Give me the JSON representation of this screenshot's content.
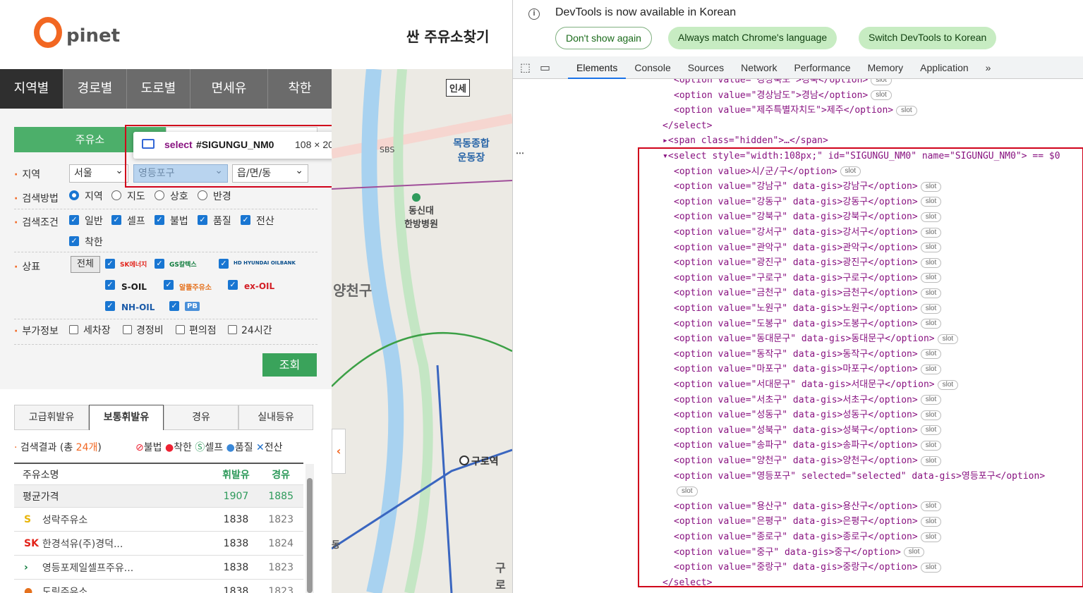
{
  "header": {
    "logo_big": "O",
    "logo_rest": "pinet",
    "title": "싼 주유소찾기"
  },
  "main_tabs": [
    {
      "label": "지역별",
      "active": true
    },
    {
      "label": "경로별"
    },
    {
      "label": "도로별"
    },
    {
      "label": "면세유"
    },
    {
      "label": "착한"
    }
  ],
  "search": {
    "kind_tab": "주유소",
    "region_label": "지역",
    "sido_value": "서울",
    "sigungu_value": "영등포구",
    "dong_value": "읍/면/동",
    "method_label": "검색방법",
    "methods": [
      "지역",
      "지도",
      "상호",
      "반경"
    ],
    "cond_label": "검색조건",
    "conds": [
      "일반",
      "셀프",
      "불법",
      "품질",
      "전산",
      "착한"
    ],
    "brand_label": "상표",
    "all_button": "전체",
    "brands": [
      "SK에너지",
      "GS칼텍스",
      "HD HYUNDAI OILBANK",
      "S-OIL",
      "알뜰주유소",
      "ex-OIL",
      "NH-OIL",
      "PB"
    ],
    "extra_label": "부가정보",
    "extras": [
      "세차장",
      "경정비",
      "편의점",
      "24시간"
    ],
    "submit": "조회"
  },
  "inspector_tooltip": {
    "tag": "select",
    "id": "#SIGUNGU_NM0",
    "size": "108 × 20"
  },
  "fuel_tabs": [
    {
      "label": "고급휘발유"
    },
    {
      "label": "보통휘발유",
      "active": true
    },
    {
      "label": "경유"
    },
    {
      "label": "실내등유"
    }
  ],
  "results": {
    "prefix": "검색결과 (총 ",
    "count": "24개",
    "suffix": ")",
    "legend": [
      "불법",
      "착한",
      "셀프",
      "품질",
      "전산"
    ],
    "headers": [
      "주유소명",
      "휘발유",
      "경유"
    ],
    "avg": {
      "name": "평균가격",
      "gas": "1907",
      "diesel": "1885"
    },
    "rows": [
      {
        "name": "성락주유소",
        "gas": "1838",
        "diesel": "1823",
        "brand_icon": "s-oil-icon",
        "tags": [
          "self",
          "computerized"
        ]
      },
      {
        "name": "한경석유(주)경덕...",
        "gas": "1838",
        "diesel": "1824",
        "brand_icon": "sk-icon",
        "tags": [
          "self"
        ]
      },
      {
        "name": "영등포제일셀프주유...",
        "gas": "1838",
        "diesel": "1823",
        "brand_icon": "gs-icon",
        "tags": [
          "self",
          "good"
        ]
      },
      {
        "name": "도림주유소",
        "gas": "1838",
        "diesel": "1823",
        "brand_icon": "alddeul-icon",
        "tags": [
          "self"
        ]
      }
    ]
  },
  "map": {
    "labels": [
      "인세",
      "SBS",
      "목동종합\n운동장",
      "동신대\n한방병원",
      "양천구",
      "구로역",
      "구로",
      "동"
    ]
  },
  "devtools": {
    "info": "DevTools is now available in Korean",
    "btn_dont": "Don't show again",
    "btn_match": "Always match Chrome's language",
    "btn_switch": "Switch DevTools to Korean",
    "tabs": [
      "Elements",
      "Console",
      "Sources",
      "Network",
      "Performance",
      "Memory",
      "Application"
    ],
    "more": "»",
    "lines": [
      {
        "html": "&lt;option value=\"경상북도\"&gt;경북&lt;/option&gt;",
        "slot": true,
        "indent": 2
      },
      {
        "html": "&lt;option value=\"경상남도\"&gt;경남&lt;/option&gt;",
        "slot": true,
        "indent": 2
      },
      {
        "html": "&lt;option value=\"제주특별자치도\"&gt;제주&lt;/option&gt;",
        "slot": true,
        "indent": 2
      },
      {
        "html": "&lt;/select&gt;",
        "indent": 1
      },
      {
        "html": "▸&lt;span class=\"hidden\"&gt;…&lt;/span&gt;",
        "indent": 1
      },
      {
        "html": "▾&lt;select style=\"width:108px;\" id=\"SIGUNGU_NM0\" name=\"SIGUNGU_NM0\"&gt; == $0",
        "indent": 1
      },
      {
        "html": "&lt;option value&gt;시/군/구&lt;/option&gt;",
        "slot": true,
        "indent": 2
      }
    ],
    "options": [
      "강남구",
      "강동구",
      "강북구",
      "강서구",
      "관악구",
      "광진구",
      "구로구",
      "금천구",
      "노원구",
      "도봉구",
      "동대문구",
      "동작구",
      "마포구",
      "서대문구",
      "서초구",
      "성동구",
      "성북구",
      "송파구",
      "양천구",
      "영등포구",
      "용산구",
      "은평구",
      "종로구",
      "중구",
      "중랑구"
    ],
    "selected": "영등포구",
    "close": "&lt;/select&gt;",
    "slot_label": "slot"
  }
}
